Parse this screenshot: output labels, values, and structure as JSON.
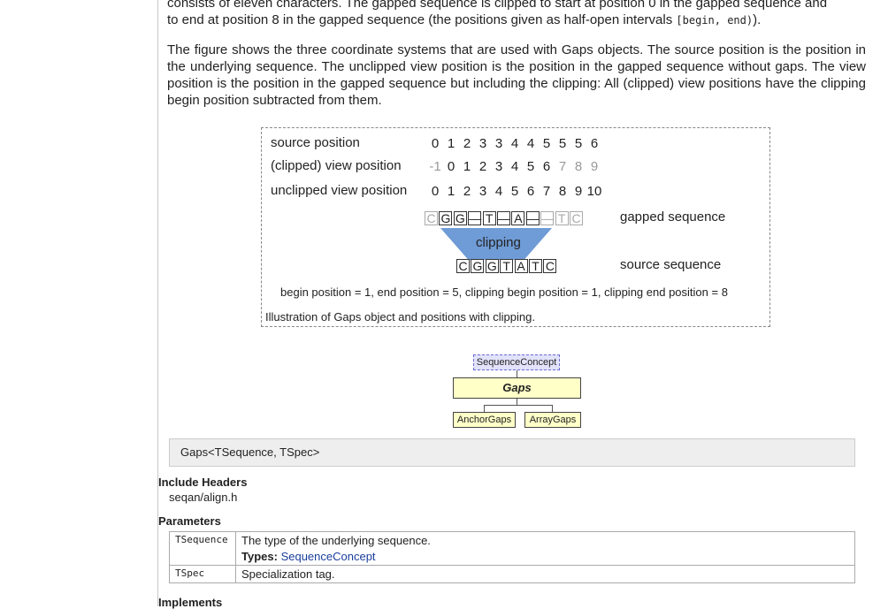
{
  "intro": {
    "line1": "consists of eleven characters. The gapped sequence is clipped to start at position 0 in the gapped sequence and",
    "line2_pre": "to end at position 8 in the gapped sequence (the positions given as half-open intervals ",
    "line2_code1": "[begin, end)",
    "line2_post": ").",
    "para2": "The figure shows the three coordinate systems that are used with Gaps objects. The source position is the position in the underlying sequence. The unclipped view position is the position in the gapped sequence without gaps. The view position is the position in the gapped sequence but including the clipping: All (clipped) view positions have the clipping begin position subtracted from them."
  },
  "figure": {
    "row_labels": [
      "source position",
      "(clipped) view position",
      "unclipped view position"
    ],
    "source_positions": [
      "0",
      "1",
      "2",
      "3",
      "3",
      "4",
      "4",
      "5",
      "5",
      "5",
      "6"
    ],
    "clipped_view_positions": [
      "-1",
      "0",
      "1",
      "2",
      "3",
      "4",
      "5",
      "6",
      "7",
      "8",
      "9"
    ],
    "unclipped_view_positions": [
      "0",
      "1",
      "2",
      "3",
      "4",
      "5",
      "6",
      "7",
      "8",
      "9",
      "10"
    ],
    "gapped_sequence": [
      "C",
      "G",
      "G",
      "—",
      "T",
      "—",
      "A",
      "—",
      "—",
      "T",
      "C"
    ],
    "source_sequence": [
      "C",
      "G",
      "G",
      "T",
      "A",
      "T",
      "C"
    ],
    "clipping_label": "clipping",
    "gapped_label": "gapped sequence",
    "source_label": "source sequence",
    "positions_line": "begin position = 1, end position = 5, clipping begin position = 1, clipping end position = 8",
    "caption": "Illustration of Gaps object and positions with clipping."
  },
  "hierarchy": {
    "concept": "SequenceConcept",
    "class": "Gaps",
    "children": [
      "AnchorGaps",
      "ArrayGaps"
    ]
  },
  "signature": "Gaps<TSequence, TSpec>",
  "include": {
    "heading": "Include Headers",
    "value": "seqan/align.h"
  },
  "parameters": {
    "heading": "Parameters",
    "rows": [
      {
        "name": "TSequence",
        "desc": "The type of the underlying sequence.",
        "types_label": "Types:",
        "types_link": "SequenceConcept"
      },
      {
        "name": "TSpec",
        "desc": "Specialization tag."
      }
    ]
  },
  "implements_heading": "Implements"
}
